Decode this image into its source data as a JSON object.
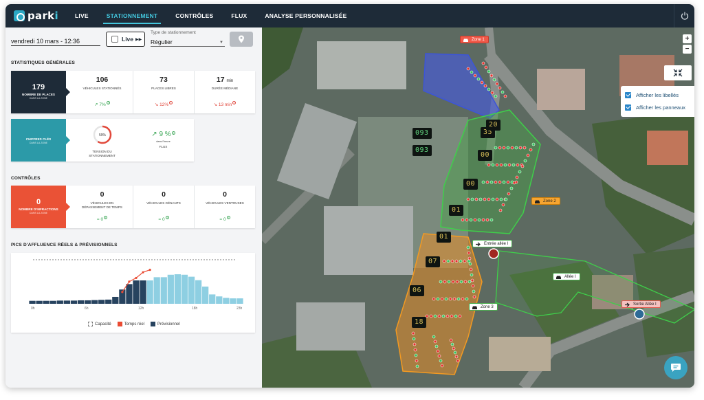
{
  "app": {
    "logo_text": "park",
    "logo_suffix": "i"
  },
  "nav": {
    "items": [
      {
        "label": "LIVE",
        "active": false
      },
      {
        "label": "STATIONNEMENT",
        "active": true
      },
      {
        "label": "CONTRÔLES",
        "active": false
      },
      {
        "label": "FLUX",
        "active": false
      },
      {
        "label": "ANALYSE PERSONNALISÉE",
        "active": false
      }
    ]
  },
  "filters": {
    "date": "vendredi 10 mars - 12:36",
    "live_label": "Live",
    "type_label": "Type de stationnement",
    "type_value": "Régulier"
  },
  "stats": {
    "title": "STATISTIQUES GÉNÉRALES",
    "badge": {
      "value": "179",
      "label": "NOMBRE DE PLACES",
      "sub": "DANS LA ZONE"
    },
    "kpis": [
      {
        "value": "106",
        "unit": "",
        "label": "VÉHICULES STATIONNÉS",
        "trend": "↗ 7%",
        "dir": "up"
      },
      {
        "value": "73",
        "unit": "",
        "label": "PLACES LIBRES",
        "trend": "↘ 12%",
        "dir": "down"
      },
      {
        "value": "17",
        "unit": "min",
        "label": "DURÉE MÉDIANE",
        "trend": "↘ 13 min",
        "dir": "down"
      }
    ]
  },
  "key_figures": {
    "badge": {
      "label": "CHIFFRES CLÉS",
      "sub": "DANS LA ZONE"
    },
    "gauge": {
      "value": "59%",
      "fraction": 0.59,
      "label_line1": "TENSION DU",
      "label_line2": "STATIONNEMENT"
    },
    "flux": {
      "value": "↗ 9 %",
      "sub": "dans l'heure",
      "label": "FLUX"
    }
  },
  "controls": {
    "title": "CONTRÔLES",
    "badge": {
      "value": "0",
      "label": "NOMBRE D'INFRACTIONS",
      "sub": "DANS LA ZONE"
    },
    "kpis": [
      {
        "value": "0",
        "label_line1": "VÉHICULES EN",
        "label_line2": "DÉPASSEMENT DE TEMPS",
        "trend": "= 0"
      },
      {
        "value": "0",
        "label_line1": "VÉHICULES GÉNANTS",
        "label_line2": "",
        "trend": "= 0"
      },
      {
        "value": "0",
        "label_line1": "VÉHICULES VENTOUSES",
        "label_line2": "",
        "trend": "= 0"
      }
    ]
  },
  "peaks": {
    "title": "PICS D'AFFLUENCE RÉELS & PRÉVISIONNELS",
    "legend": {
      "capacity": "Capacité",
      "real": "Temps réel",
      "forecast": "Prévisionnel"
    }
  },
  "chart_data": {
    "type": "bar",
    "x_ticks": [
      "0h",
      "6h",
      "12h",
      "18h",
      "23h"
    ],
    "capacity": 179,
    "forecast_past": [
      12,
      12,
      12,
      12,
      13,
      13,
      13,
      14,
      14,
      15,
      16,
      17,
      28,
      58,
      80,
      95,
      95
    ],
    "forecast_future": [
      95,
      108,
      108,
      118,
      120,
      118,
      110,
      96,
      70,
      38,
      30,
      24,
      22,
      22
    ],
    "real_time_x": [
      13,
      14,
      15,
      16,
      17
    ],
    "real_time_y": [
      48,
      90,
      105,
      128,
      138
    ],
    "colors": {
      "past": "#27435f",
      "future": "#8ecfe2",
      "real": "#ea4b33",
      "capacity": "#777777"
    }
  },
  "map": {
    "options": [
      {
        "label": "Afficher les libellés",
        "checked": true
      },
      {
        "label": "Afficher les panneaux",
        "checked": true
      }
    ],
    "zoom_in": "+",
    "zoom_out": "−",
    "tags": [
      {
        "label": "Zone 1",
        "style": "red"
      },
      {
        "label": "Zone 2",
        "style": "orange"
      },
      {
        "label": "Zone 3",
        "style": "white"
      },
      {
        "label": "Entrée allée I",
        "style": "white"
      },
      {
        "label": "Allée I",
        "style": "white"
      },
      {
        "label": "Sortie Allée I",
        "style": "pink"
      }
    ],
    "counters": [
      "093",
      "093",
      "35",
      "00",
      "00",
      "01",
      "01",
      "07",
      "06",
      "18",
      "20"
    ]
  }
}
